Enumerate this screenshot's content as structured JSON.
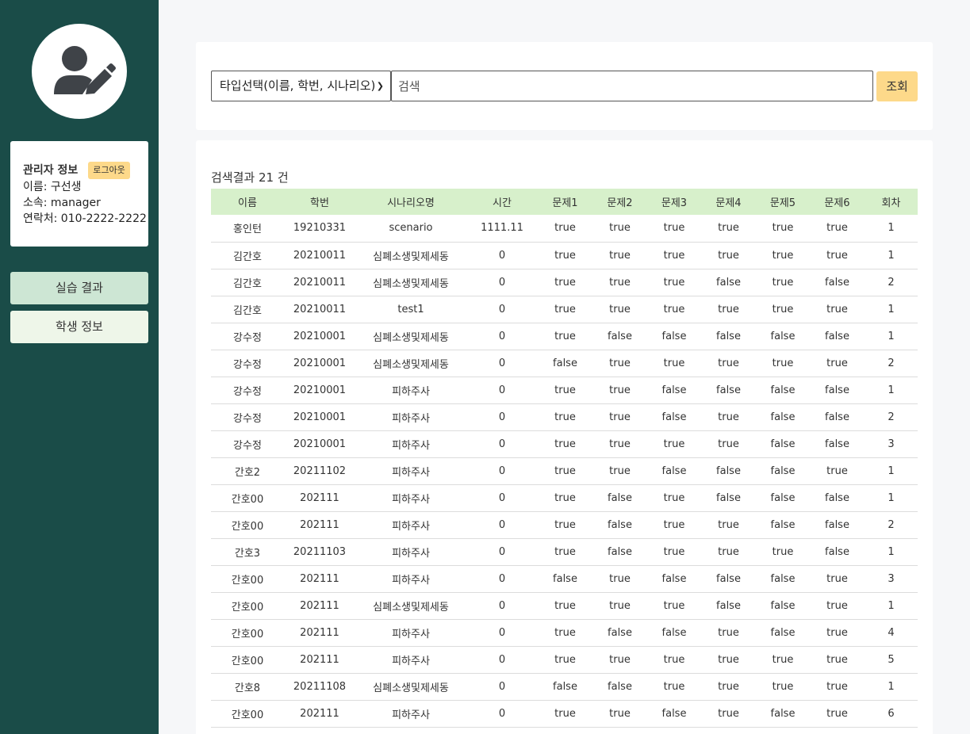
{
  "sidebar": {
    "admin": {
      "title": "관리자 정보",
      "logout_label": "로그아웃",
      "name_line": "이름: 구선생",
      "affiliation_line": "소속: manager",
      "contact_line": "연락처: 010-2222-2222"
    },
    "nav": {
      "results_label": "실습 결과",
      "students_label": "학생 정보"
    }
  },
  "search": {
    "type_select_value": "타입선택(이름, 학번, 시나리오)",
    "placeholder": "검색",
    "query_label": "조회"
  },
  "results": {
    "count_label": "검색결과 21 건",
    "columns": [
      "이름",
      "학번",
      "시나리오명",
      "시간",
      "문제1",
      "문제2",
      "문제3",
      "문제4",
      "문제5",
      "문제6",
      "회차"
    ],
    "rows": [
      [
        "홍인턴",
        "19210331",
        "scenario",
        "1111.11",
        "true",
        "true",
        "true",
        "true",
        "true",
        "true",
        "1"
      ],
      [
        "김간호",
        "20210011",
        "심폐소생및제세동",
        "0",
        "true",
        "true",
        "true",
        "true",
        "true",
        "true",
        "1"
      ],
      [
        "김간호",
        "20210011",
        "심폐소생및제세동",
        "0",
        "true",
        "true",
        "true",
        "false",
        "true",
        "false",
        "2"
      ],
      [
        "김간호",
        "20210011",
        "test1",
        "0",
        "true",
        "true",
        "true",
        "true",
        "true",
        "true",
        "1"
      ],
      [
        "강수정",
        "20210001",
        "심폐소생및제세동",
        "0",
        "true",
        "false",
        "false",
        "false",
        "false",
        "false",
        "1"
      ],
      [
        "강수정",
        "20210001",
        "심폐소생및제세동",
        "0",
        "false",
        "true",
        "true",
        "true",
        "true",
        "true",
        "2"
      ],
      [
        "강수정",
        "20210001",
        "피하주사",
        "0",
        "true",
        "true",
        "false",
        "false",
        "false",
        "false",
        "1"
      ],
      [
        "강수정",
        "20210001",
        "피하주사",
        "0",
        "true",
        "true",
        "false",
        "true",
        "false",
        "false",
        "2"
      ],
      [
        "강수정",
        "20210001",
        "피하주사",
        "0",
        "true",
        "true",
        "true",
        "true",
        "false",
        "false",
        "3"
      ],
      [
        "간호2",
        "20211102",
        "피하주사",
        "0",
        "true",
        "true",
        "false",
        "false",
        "false",
        "true",
        "1"
      ],
      [
        "간호00",
        "202111",
        "피하주사",
        "0",
        "true",
        "false",
        "true",
        "false",
        "false",
        "false",
        "1"
      ],
      [
        "간호00",
        "202111",
        "피하주사",
        "0",
        "true",
        "false",
        "true",
        "true",
        "false",
        "false",
        "2"
      ],
      [
        "간호3",
        "20211103",
        "피하주사",
        "0",
        "true",
        "false",
        "true",
        "true",
        "true",
        "false",
        "1"
      ],
      [
        "간호00",
        "202111",
        "피하주사",
        "0",
        "false",
        "true",
        "false",
        "false",
        "false",
        "true",
        "3"
      ],
      [
        "간호00",
        "202111",
        "심폐소생및제세동",
        "0",
        "true",
        "true",
        "true",
        "false",
        "false",
        "true",
        "1"
      ],
      [
        "간호00",
        "202111",
        "피하주사",
        "0",
        "true",
        "false",
        "false",
        "true",
        "false",
        "true",
        "4"
      ],
      [
        "간호00",
        "202111",
        "피하주사",
        "0",
        "true",
        "true",
        "true",
        "true",
        "true",
        "true",
        "5"
      ],
      [
        "간호8",
        "20211108",
        "심폐소생및제세동",
        "0",
        "false",
        "false",
        "true",
        "true",
        "true",
        "true",
        "1"
      ],
      [
        "간호00",
        "202111",
        "피하주사",
        "0",
        "true",
        "true",
        "false",
        "true",
        "false",
        "true",
        "6"
      ]
    ]
  },
  "colors": {
    "sidebar_bg": "#1a4c48",
    "header_row_bg": "#d7f0cb",
    "accent_button": "#fdd98a",
    "nav_active_bg": "#cde6d4",
    "nav_inactive_bg": "#eef6e9"
  },
  "icons": {
    "avatar": "user-edit-icon",
    "select_chevron": "chevron-down-icon"
  }
}
